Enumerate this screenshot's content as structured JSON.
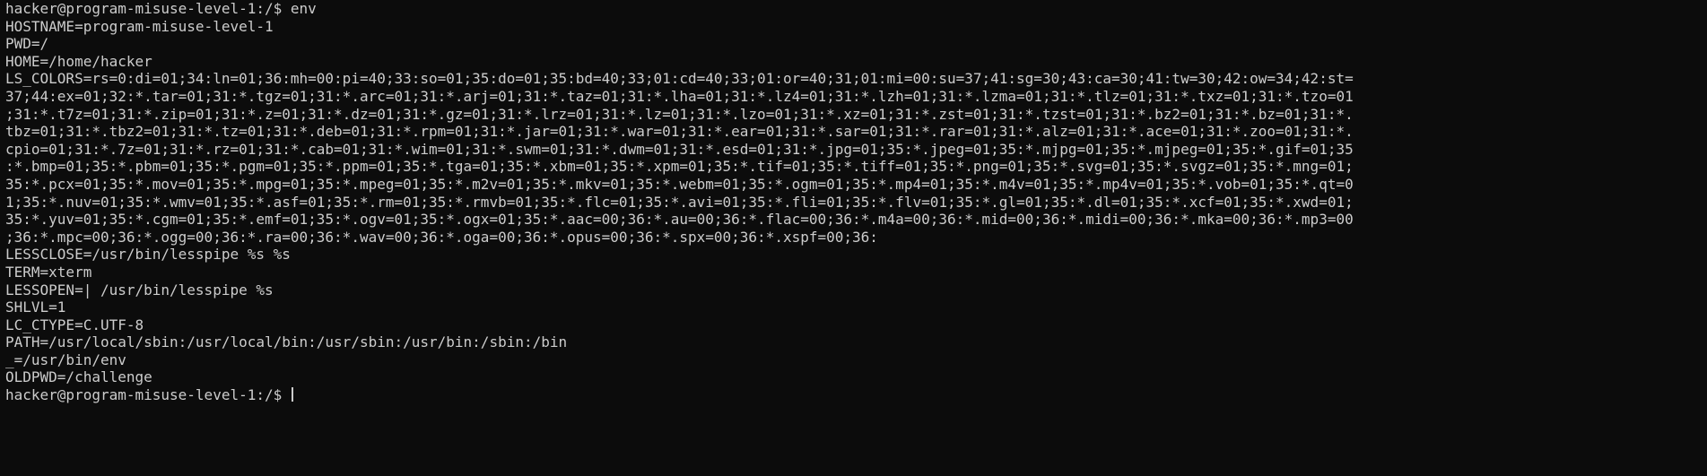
{
  "terminal": {
    "prompt": "hacker@program-misuse-level-1:/$ ",
    "command": "env",
    "output": [
      "HOSTNAME=program-misuse-level-1",
      "PWD=/",
      "HOME=/home/hacker",
      "LS_COLORS=rs=0:di=01;34:ln=01;36:mh=00:pi=40;33:so=01;35:do=01;35:bd=40;33;01:cd=40;33;01:or=40;31;01:mi=00:su=37;41:sg=30;43:ca=30;41:tw=30;42:ow=34;42:st=",
      "37;44:ex=01;32:*.tar=01;31:*.tgz=01;31:*.arc=01;31:*.arj=01;31:*.taz=01;31:*.lha=01;31:*.lz4=01;31:*.lzh=01;31:*.lzma=01;31:*.tlz=01;31:*.txz=01;31:*.tzo=01",
      ";31:*.t7z=01;31:*.zip=01;31:*.z=01;31:*.dz=01;31:*.gz=01;31:*.lrz=01;31:*.lz=01;31:*.lzo=01;31:*.xz=01;31:*.zst=01;31:*.tzst=01;31:*.bz2=01;31:*.bz=01;31:*.",
      "tbz=01;31:*.tbz2=01;31:*.tz=01;31:*.deb=01;31:*.rpm=01;31:*.jar=01;31:*.war=01;31:*.ear=01;31:*.sar=01;31:*.rar=01;31:*.alz=01;31:*.ace=01;31:*.zoo=01;31:*.",
      "cpio=01;31:*.7z=01;31:*.rz=01;31:*.cab=01;31:*.wim=01;31:*.swm=01;31:*.dwm=01;31:*.esd=01;31:*.jpg=01;35:*.jpeg=01;35:*.mjpg=01;35:*.mjpeg=01;35:*.gif=01;35",
      ":*.bmp=01;35:*.pbm=01;35:*.pgm=01;35:*.ppm=01;35:*.tga=01;35:*.xbm=01;35:*.xpm=01;35:*.tif=01;35:*.tiff=01;35:*.png=01;35:*.svg=01;35:*.svgz=01;35:*.mng=01;",
      "35:*.pcx=01;35:*.mov=01;35:*.mpg=01;35:*.mpeg=01;35:*.m2v=01;35:*.mkv=01;35:*.webm=01;35:*.ogm=01;35:*.mp4=01;35:*.m4v=01;35:*.mp4v=01;35:*.vob=01;35:*.qt=0",
      "1;35:*.nuv=01;35:*.wmv=01;35:*.asf=01;35:*.rm=01;35:*.rmvb=01;35:*.flc=01;35:*.avi=01;35:*.fli=01;35:*.flv=01;35:*.gl=01;35:*.dl=01;35:*.xcf=01;35:*.xwd=01;",
      "35:*.yuv=01;35:*.cgm=01;35:*.emf=01;35:*.ogv=01;35:*.ogx=01;35:*.aac=00;36:*.au=00;36:*.flac=00;36:*.m4a=00;36:*.mid=00;36:*.midi=00;36:*.mka=00;36:*.mp3=00",
      ";36:*.mpc=00;36:*.ogg=00;36:*.ra=00;36:*.wav=00;36:*.oga=00;36:*.opus=00;36:*.spx=00;36:*.xspf=00;36:",
      "LESSCLOSE=/usr/bin/lesspipe %s %s",
      "TERM=xterm",
      "LESSOPEN=| /usr/bin/lesspipe %s",
      "SHLVL=1",
      "LC_CTYPE=C.UTF-8",
      "PATH=/usr/local/sbin:/usr/local/bin:/usr/sbin:/usr/bin:/sbin:/bin",
      "_=/usr/bin/env",
      "OLDPWD=/challenge"
    ],
    "next_prompt": "hacker@program-misuse-level-1:/$ "
  },
  "colors": {
    "background": "#0c0c0c",
    "foreground": "#cccccc"
  }
}
